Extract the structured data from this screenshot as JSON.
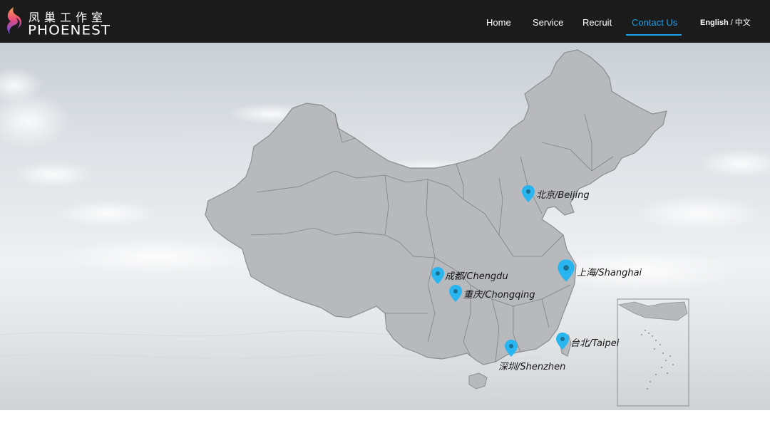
{
  "header": {
    "logo": {
      "cn": "凤巢工作室",
      "en": "PHOENEST"
    },
    "nav": [
      {
        "label": "Home"
      },
      {
        "label": "Service"
      },
      {
        "label": "Recruit"
      },
      {
        "label": "Contact Us",
        "active": true
      }
    ],
    "lang": {
      "english": "English",
      "separator": "/",
      "chinese": "中文"
    }
  },
  "map": {
    "cities": [
      {
        "id": "beijing",
        "label": "北京/Beijing"
      },
      {
        "id": "shanghai",
        "label": "上海/Shanghai",
        "emphasis": true
      },
      {
        "id": "chengdu",
        "label": "成都/Chengdu"
      },
      {
        "id": "chongqing",
        "label": "重庆/Chongqing"
      },
      {
        "id": "taipei",
        "label": "台北/Taipei"
      },
      {
        "id": "shenzhen",
        "label": "深圳/Shenzhen"
      }
    ]
  },
  "colors": {
    "header_bg": "#1b1b1b",
    "accent": "#1e9fe8",
    "pin": "#29b6f0",
    "map_fill": "#b7b9bc",
    "map_border": "#6e7074"
  }
}
